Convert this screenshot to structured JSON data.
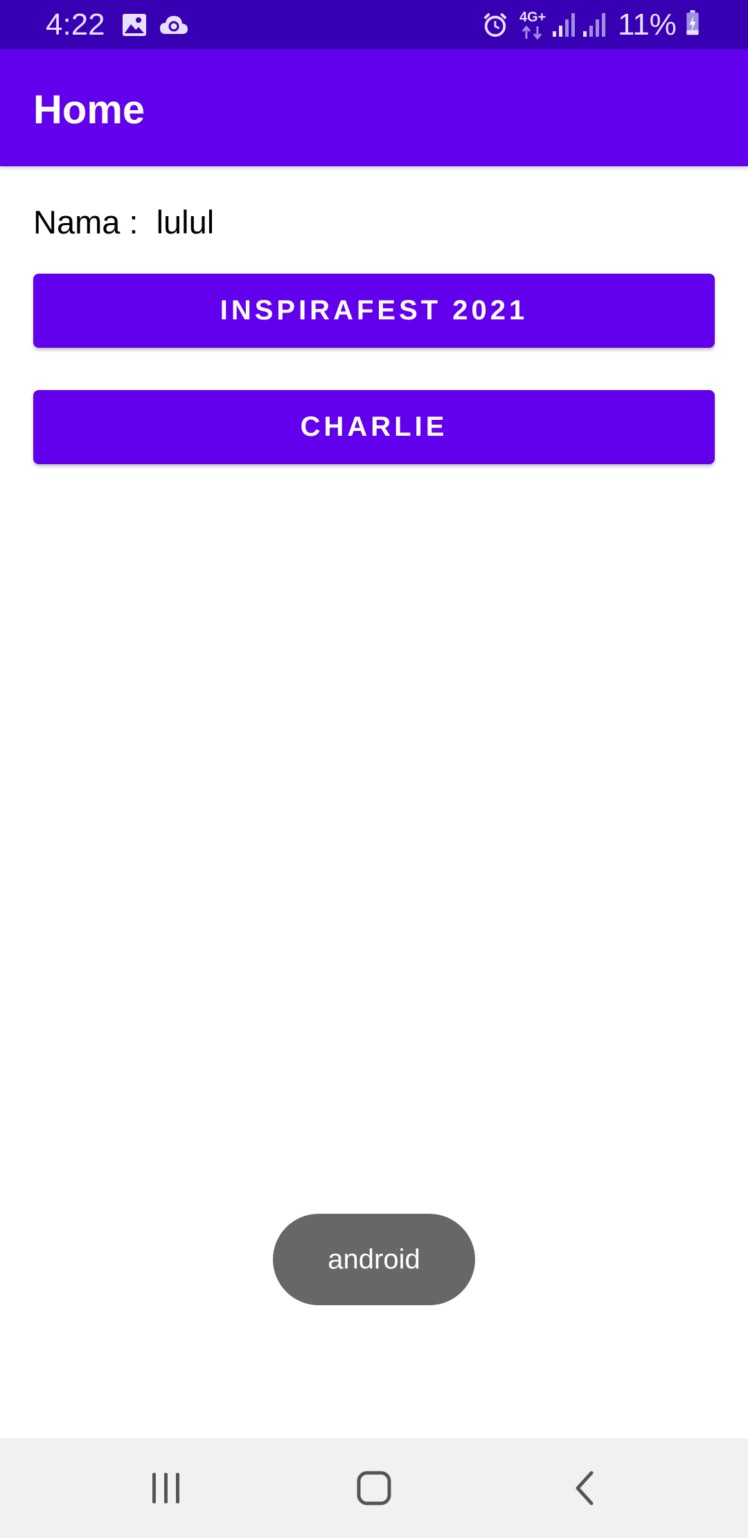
{
  "status_bar": {
    "time": "4:22",
    "network": "4G+",
    "battery_percent": "11%",
    "icons": [
      "image-icon",
      "cloud-sync-icon",
      "alarm-icon",
      "network-4g-icon",
      "signal-icon",
      "signal-icon",
      "battery-charging-icon"
    ]
  },
  "app_bar": {
    "title": "Home"
  },
  "content": {
    "name_label": "Nama :  lulul",
    "buttons": [
      {
        "label": "INSPIRAFEST 2021"
      },
      {
        "label": "CHARLIE"
      }
    ]
  },
  "toast": {
    "message": "android"
  },
  "nav_bar": {
    "icons": [
      "recents-icon",
      "home-icon",
      "back-icon"
    ]
  },
  "colors": {
    "status_bar": "#3700b3",
    "primary": "#6200ee",
    "toast": "#676767",
    "nav_bar": "#f1f1f1"
  }
}
